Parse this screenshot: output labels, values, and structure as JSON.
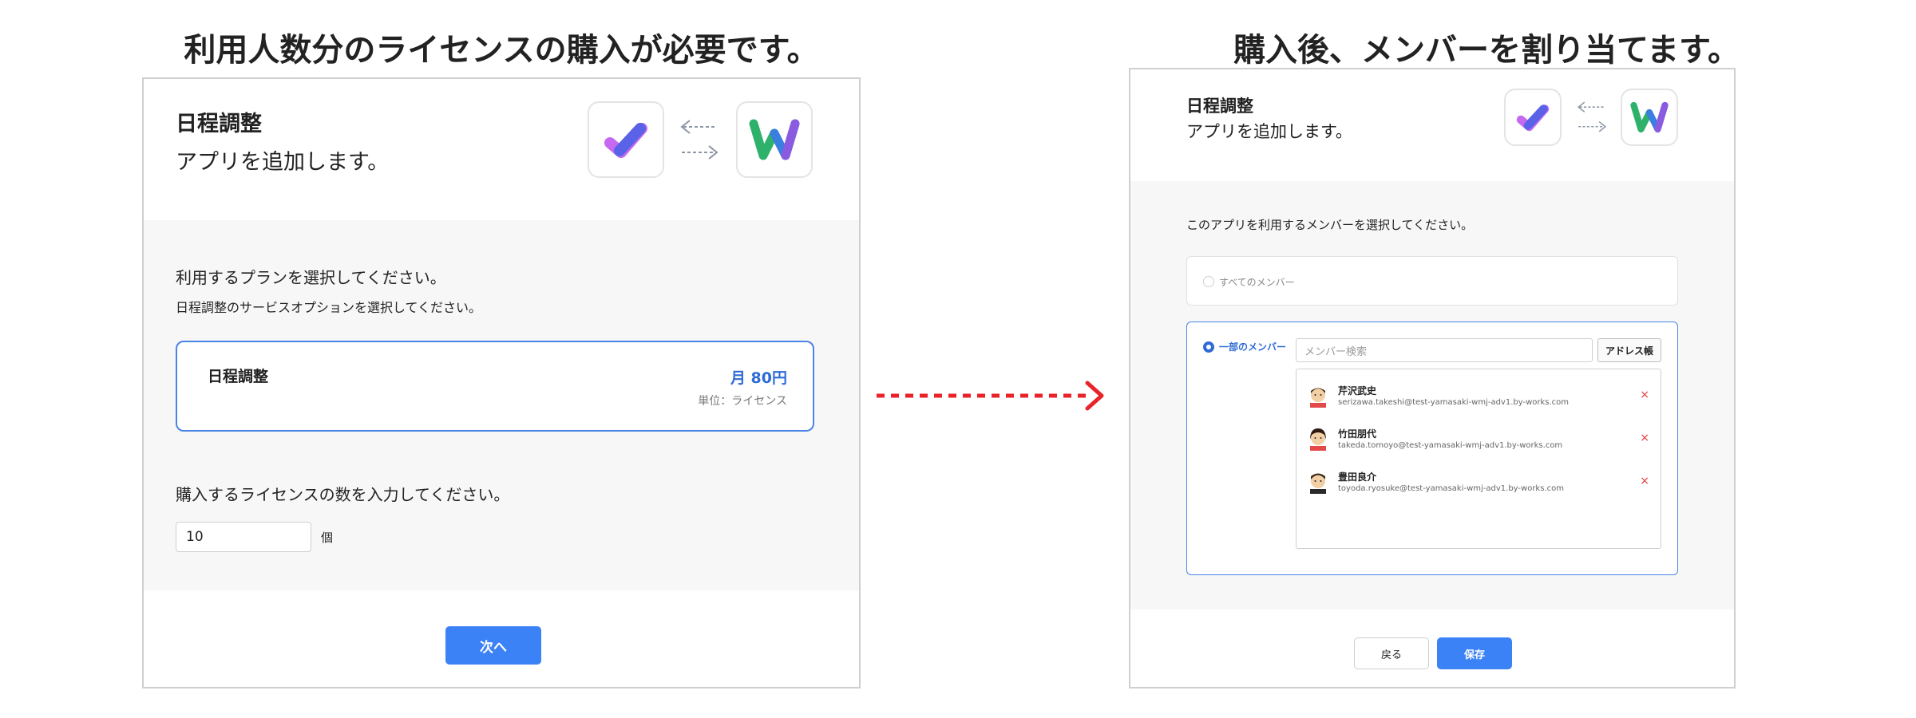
{
  "headings": {
    "left": "利用人数分のライセンスの購入が必要です。",
    "right": "購入後、メンバーを割り当てます。"
  },
  "colors": {
    "accent": "#3b82f6",
    "arrow": "#e8232a",
    "card_border": "#4a83e6",
    "remove": "#e03b3b"
  },
  "left_panel": {
    "app_name": "日程調整",
    "app_desc": "アプリを追加します。",
    "icons": [
      "scheduler-app-icon",
      "sync-arrows-icon",
      "works-logo-icon"
    ],
    "plan_prompt": "利用するプランを選択してください。",
    "plan_sub": "日程調整のサービスオプションを選択してください。",
    "plan": {
      "name": "日程調整",
      "price": "月 80円",
      "unit": "単位：ライセンス"
    },
    "qty_prompt": "購入するライセンスの数を入力してください。",
    "qty_value": "10",
    "qty_unit": "個",
    "next_button": "次へ"
  },
  "right_panel": {
    "app_name": "日程調整",
    "app_desc": "アプリを追加します。",
    "member_prompt": "このアプリを利用するメンバーを選択してください。",
    "all_members_label": "すべてのメンバー",
    "some_members_label": "一部のメンバー",
    "search_placeholder": "メンバー検索",
    "address_book_button": "アドレス帳",
    "members": [
      {
        "name": "芹沢武史",
        "email": "serizawa.takeshi@test-yamasaki-wmj-adv1.by-works.com"
      },
      {
        "name": "竹田朋代",
        "email": "takeda.tomoyo@test-yamasaki-wmj-adv1.by-works.com"
      },
      {
        "name": "豊田良介",
        "email": "toyoda.ryosuke@test-yamasaki-wmj-adv1.by-works.com"
      }
    ],
    "remove_symbol": "×",
    "back_button": "戻る",
    "save_button": "保存"
  }
}
